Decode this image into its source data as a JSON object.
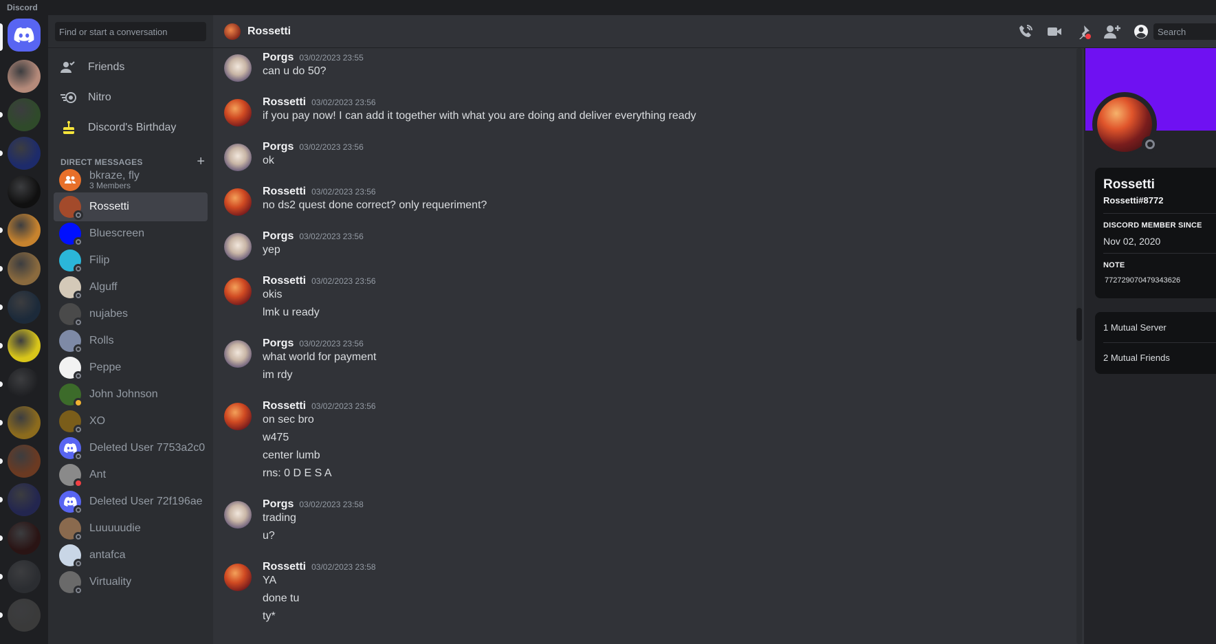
{
  "app": {
    "title": "Discord"
  },
  "rail": {
    "servers": [
      {
        "icon": "server-icon-face",
        "color": "#b58a7a"
      },
      {
        "icon": "server-icon-star-miners",
        "color": "#2f4a2a"
      },
      {
        "icon": "server-icon-district",
        "color": "#1d2b6b"
      },
      {
        "icon": "server-icon-crown",
        "color": "#101010"
      },
      {
        "icon": "server-icon-treasure-chest",
        "color": "#c7832e"
      },
      {
        "icon": "server-icon-news",
        "color": "#8a6a3e"
      },
      {
        "icon": "server-icon-diamond",
        "color": "#1c2a3a"
      },
      {
        "icon": "server-icon-boss-service",
        "color": "#d9c61a"
      },
      {
        "icon": "server-icon-bar-chart",
        "color": "#1e1f22"
      },
      {
        "icon": "server-icon-xo-gold",
        "color": "#8c6b1d"
      },
      {
        "icon": "server-icon-brown-creature",
        "color": "#6b3a22"
      },
      {
        "icon": "server-icon-dark-figure",
        "color": "#23264f"
      },
      {
        "icon": "server-icon-hooded",
        "color": "#2a1414"
      },
      {
        "icon": "server-icon-letter-a",
        "color": "#2b2d31"
      },
      {
        "icon": "server-icon-grey-creature",
        "color": "#3a3a3a"
      }
    ]
  },
  "sidebar": {
    "search_placeholder": "Find or start a conversation",
    "nav": [
      {
        "label": "Friends",
        "icon": "friends-icon"
      },
      {
        "label": "Nitro",
        "icon": "nitro-icon"
      },
      {
        "label": "Discord's Birthday",
        "icon": "birthday-cake-icon"
      }
    ],
    "dm_header": "DIRECT MESSAGES",
    "dms": [
      {
        "name": "bkraze, fly",
        "sub": "3 Members",
        "avatar_color": "#e8702a",
        "status": "none",
        "group": true
      },
      {
        "name": "Rossetti",
        "avatar_color": "#a34a2b",
        "status": "offline",
        "active": true
      },
      {
        "name": "Bluescreen",
        "avatar_color": "#0010ff",
        "status": "offline"
      },
      {
        "name": "Filip",
        "avatar_color": "#2bb6d9",
        "status": "offline"
      },
      {
        "name": "Alguff",
        "avatar_color": "#d4c9b8",
        "status": "offline"
      },
      {
        "name": "nujabes",
        "avatar_color": "#4a4a4a",
        "status": "offline"
      },
      {
        "name": "Rolls",
        "avatar_color": "#7e8aa6",
        "status": "offline"
      },
      {
        "name": "Peppe",
        "avatar_color": "#f2f2f2",
        "status": "offline"
      },
      {
        "name": "John Johnson",
        "avatar_color": "#3c6b2a",
        "status": "idle"
      },
      {
        "name": "XO",
        "avatar_color": "#7a5d1a",
        "status": "offline"
      },
      {
        "name": "Deleted User 7753a2c0",
        "avatar_color": "#5865f2",
        "status": "offline"
      },
      {
        "name": "Ant",
        "avatar_color": "#8a8a8a",
        "status": "dnd"
      },
      {
        "name": "Deleted User 72f196ae",
        "avatar_color": "#5865f2",
        "status": "offline"
      },
      {
        "name": "Luuuuudie",
        "avatar_color": "#8a6a4e",
        "status": "offline"
      },
      {
        "name": "antafca",
        "avatar_color": "#c9d6e6",
        "status": "offline"
      },
      {
        "name": "Virtuality",
        "avatar_color": "#6a6a6a",
        "status": "offline"
      }
    ]
  },
  "chat": {
    "channel_name": "Rossetti",
    "search_placeholder": "Search",
    "header_icons": [
      "voice-call-icon",
      "video-call-icon",
      "pinned-messages-icon",
      "add-friend-icon",
      "user-profile-icon"
    ],
    "messages": [
      {
        "author": "Porgs",
        "time": "03/02/2023 23:55",
        "lines": [
          "can u do 50?"
        ]
      },
      {
        "author": "Rossetti",
        "time": "03/02/2023 23:56",
        "lines": [
          "if you pay now! I can add it together with what you are doing and deliver everything ready"
        ]
      },
      {
        "author": "Porgs",
        "time": "03/02/2023 23:56",
        "lines": [
          "ok"
        ]
      },
      {
        "author": "Rossetti",
        "time": "03/02/2023 23:56",
        "lines": [
          "no ds2 quest done correct?  only requeriment?"
        ]
      },
      {
        "author": "Porgs",
        "time": "03/02/2023 23:56",
        "lines": [
          "yep"
        ]
      },
      {
        "author": "Rossetti",
        "time": "03/02/2023 23:56",
        "lines": [
          "okis",
          "lmk u ready"
        ]
      },
      {
        "author": "Porgs",
        "time": "03/02/2023 23:56",
        "lines": [
          "what world for payment",
          "im rdy"
        ]
      },
      {
        "author": "Rossetti",
        "time": "03/02/2023 23:56",
        "lines": [
          "on sec bro",
          "w475",
          "center lumb",
          "rns: 0 D E S A"
        ]
      },
      {
        "author": "Porgs",
        "time": "03/02/2023 23:58",
        "lines": [
          "trading",
          "u?"
        ]
      },
      {
        "author": "Rossetti",
        "time": "03/02/2023 23:58",
        "lines": [
          "YA",
          "done tu",
          "ty*"
        ]
      }
    ]
  },
  "profile": {
    "banner_color": "#6f11f2",
    "display_name": "Rossetti",
    "tag": "Rossetti#8772",
    "member_since_label": "DISCORD MEMBER SINCE",
    "member_since": "Nov 02, 2020",
    "note_label": "NOTE",
    "note": "772729070479343626",
    "mutual_servers": "1 Mutual Server",
    "mutual_friends": "2 Mutual Friends"
  }
}
